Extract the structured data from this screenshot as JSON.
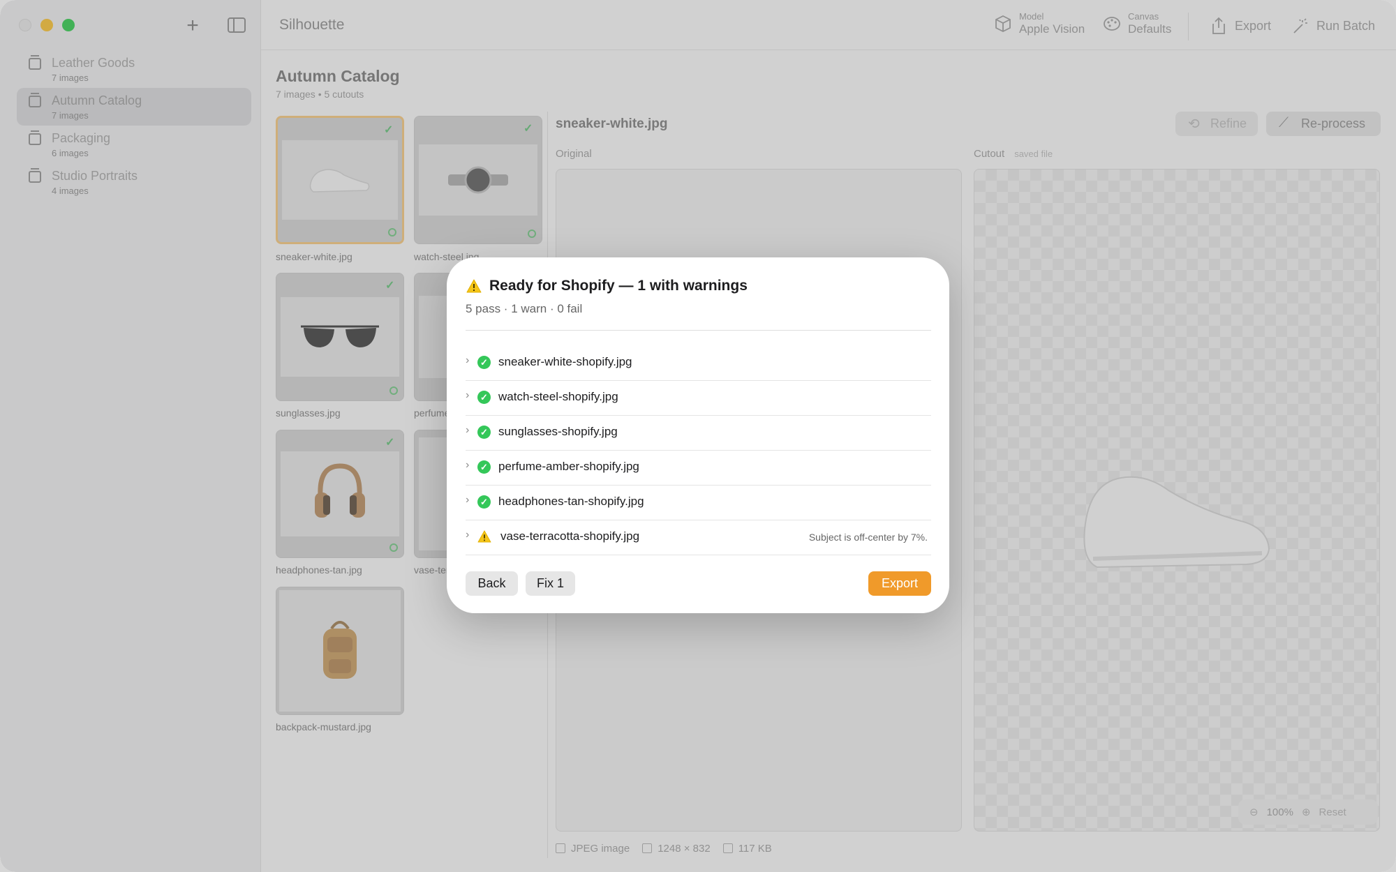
{
  "app": {
    "title": "Silhouette"
  },
  "sidebar": {
    "items": [
      {
        "name": "Leather Goods",
        "count": "7 images"
      },
      {
        "name": "Autumn Catalog",
        "count": "7 images",
        "active": true
      },
      {
        "name": "Packaging",
        "count": "6 images"
      },
      {
        "name": "Studio Portraits",
        "count": "4 images"
      }
    ]
  },
  "toolbar": {
    "model_label": "Model",
    "model_value": "Apple Vision",
    "canvas_label": "Canvas",
    "canvas_value": "Defaults",
    "export_label": "Export",
    "run_batch_label": "Run Batch"
  },
  "catalog": {
    "title": "Autumn Catalog",
    "subtitle": "7 images • 5 cutouts",
    "thumbnails": [
      {
        "caption": "sneaker-white.jpg",
        "checked": true
      },
      {
        "caption": "watch-steel.jpg",
        "checked": true
      },
      {
        "caption": "sunglasses.jpg",
        "checked": true
      },
      {
        "caption": "perfume-amber.jpg",
        "checked": false
      },
      {
        "caption": "headphones-tan.jpg",
        "checked": true
      },
      {
        "caption": "vase-terracotta.jpg",
        "checked": false
      },
      {
        "caption": "backpack-mustard.jpg",
        "checked": false
      }
    ]
  },
  "detail": {
    "title": "sneaker-white.jpg",
    "refine_label": "Refine",
    "reprocess_label": "Re-process",
    "original_label": "Original",
    "cutout_label": "Cutout",
    "cutout_note": "saved file",
    "zoom_value": "100%",
    "zoom_reset": "Reset",
    "meta_type": "JPEG image",
    "meta_dims": "1248 × 832",
    "meta_size": "117 KB"
  },
  "modal": {
    "title": "Ready for Shopify — 1 with warnings",
    "subtitle": "5 pass · 1 warn · 0 fail",
    "rows": [
      {
        "file": "sneaker-white-shopify.jpg",
        "status": "pass",
        "note": ""
      },
      {
        "file": "watch-steel-shopify.jpg",
        "status": "pass",
        "note": ""
      },
      {
        "file": "sunglasses-shopify.jpg",
        "status": "pass",
        "note": ""
      },
      {
        "file": "perfume-amber-shopify.jpg",
        "status": "pass",
        "note": ""
      },
      {
        "file": "headphones-tan-shopify.jpg",
        "status": "pass",
        "note": ""
      },
      {
        "file": "vase-terracotta-shopify.jpg",
        "status": "warn",
        "note": "Subject is off-center by 7%."
      }
    ],
    "back_label": "Back",
    "fix_label": "Fix 1",
    "export_label": "Export"
  },
  "colors": {
    "accent": "#f09a2a",
    "pass": "#34c759",
    "warn": "#f5c518"
  }
}
